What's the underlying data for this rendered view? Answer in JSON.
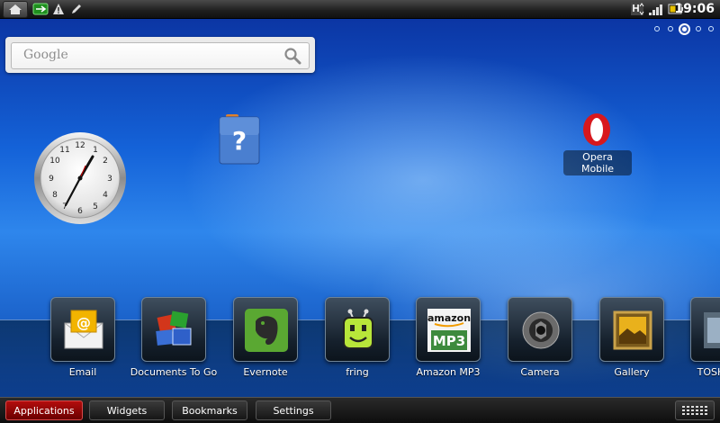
{
  "statusbar": {
    "time": "19:06",
    "icons": [
      "home-icon",
      "usb-icon",
      "warning-icon",
      "pencil-icon",
      "signal-icon",
      "battery-icon"
    ]
  },
  "homescreen": {
    "pages": 5,
    "current_page": 3
  },
  "search_widget": {
    "label": "Google"
  },
  "desktop": {
    "opera_label": "Opera Mobile"
  },
  "dock": {
    "apps": [
      {
        "label": "Email"
      },
      {
        "label": "Documents To Go"
      },
      {
        "label": "Evernote"
      },
      {
        "label": "fring"
      },
      {
        "label": "Amazon MP3"
      },
      {
        "label": "Camera"
      },
      {
        "label": "Gallery"
      },
      {
        "label": "TOSH"
      }
    ]
  },
  "amazon": {
    "brand": "amazon",
    "format": "MP3"
  },
  "bottombar": {
    "tabs": [
      "Applications",
      "Widgets",
      "Bookmarks",
      "Settings"
    ],
    "active": "Applications"
  },
  "colors": {
    "accent_active_tab": "#b30d0d",
    "wallpaper": "#1462d8"
  }
}
